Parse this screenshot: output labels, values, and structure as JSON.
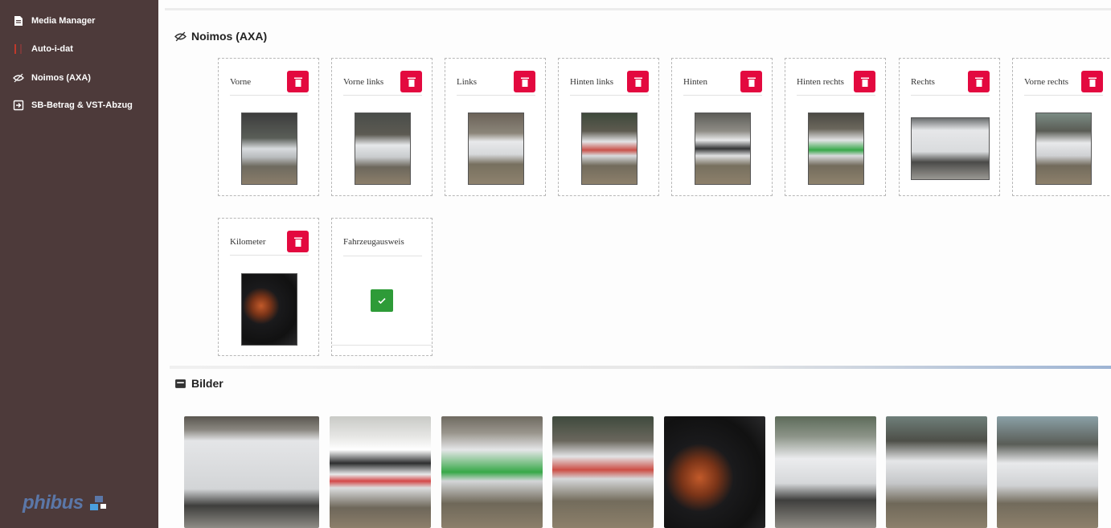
{
  "sidebar": {
    "items": [
      {
        "label": "Media Manager",
        "icon": "document-icon"
      },
      {
        "label": "Auto-i-dat",
        "icon": "red-bar-icon"
      },
      {
        "label": "Noimos (AXA)",
        "icon": "eye-icon"
      },
      {
        "label": "SB-Betrag & VST-Abzug",
        "icon": "sign-in-icon"
      }
    ],
    "logo_prefix": "",
    "logo_text": "phibus"
  },
  "noimos": {
    "title": "Noimos (AXA)",
    "cards": [
      {
        "label": "Vorne",
        "state": "photo"
      },
      {
        "label": "Vorne links",
        "state": "photo"
      },
      {
        "label": "Links",
        "state": "photo"
      },
      {
        "label": "Hinten links",
        "state": "photo"
      },
      {
        "label": "Hinten",
        "state": "photo"
      },
      {
        "label": "Hinten rechts",
        "state": "photo"
      },
      {
        "label": "Rechts",
        "state": "photo"
      },
      {
        "label": "Vorne rechts",
        "state": "photo"
      },
      {
        "label": "Kilometer",
        "state": "photo"
      },
      {
        "label": "Fahrzeugausweis",
        "state": "checked"
      }
    ]
  },
  "bilder": {
    "title": "Bilder",
    "photo_count": 8
  },
  "colors": {
    "sidebar_bg": "#4d3a3a",
    "delete_red": "#e3093f",
    "check_green": "#2e9b38",
    "logo_blue": "#5b77a8"
  }
}
